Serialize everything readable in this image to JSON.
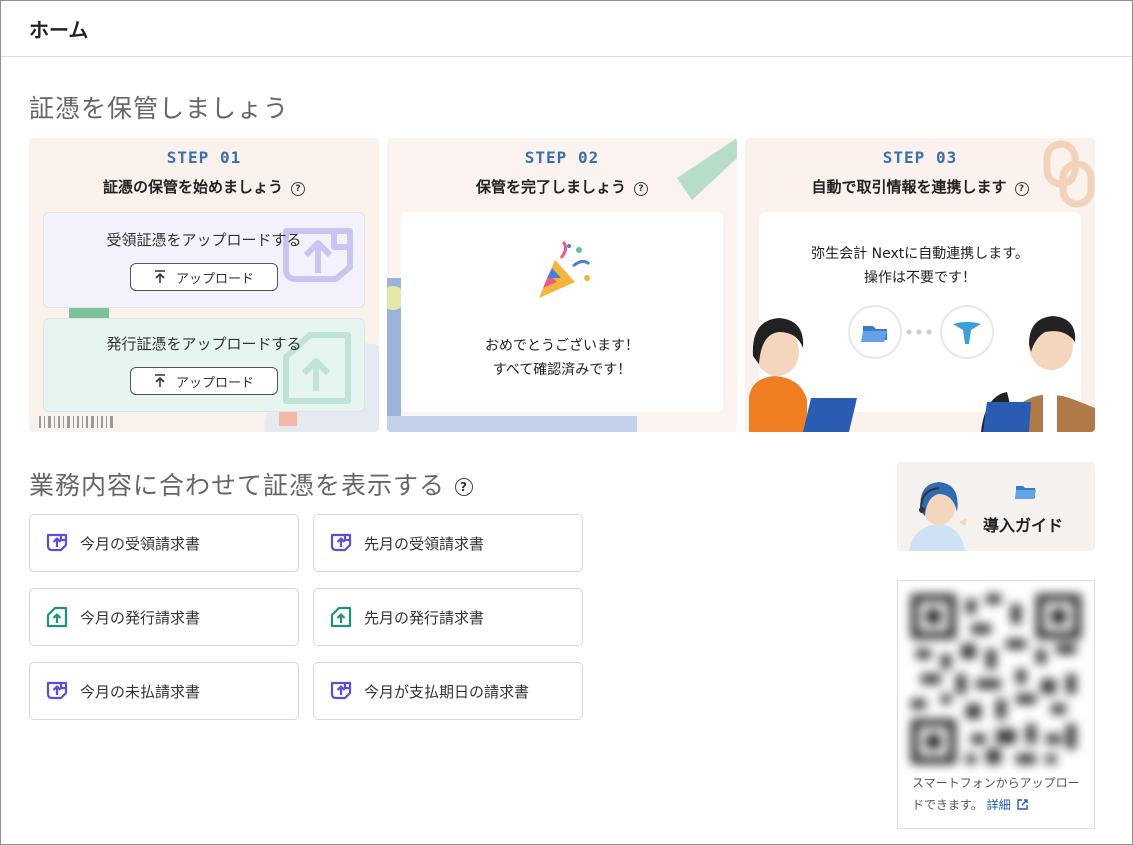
{
  "header": {
    "title": "ホーム"
  },
  "section1": {
    "title": "証憑を保管しましょう"
  },
  "steps": [
    {
      "label": "STEP 01",
      "heading": "証憑の保管を始めましょう",
      "received": {
        "label": "受領証憑をアップロードする",
        "button": "アップロード"
      },
      "issued": {
        "label": "発行証憑をアップロードする",
        "button": "アップロード"
      }
    },
    {
      "label": "STEP 02",
      "heading": "保管を完了しましょう",
      "message_line1": "おめでとうございます！",
      "message_line2": "すべて確認済みです！"
    },
    {
      "label": "STEP 03",
      "heading": "自動で取引情報を連携します",
      "message_line1": "弥生会計 Nextに自動連携します。",
      "message_line2": "操作は不要です！"
    }
  ],
  "section2": {
    "title": "業務内容に合わせて証憑を表示する"
  },
  "filters": [
    {
      "label": "今月の受領請求書",
      "icon": "receive-icon"
    },
    {
      "label": "先月の受領請求書",
      "icon": "receive-icon"
    },
    {
      "label": "今月の発行請求書",
      "icon": "issue-icon"
    },
    {
      "label": "先月の発行請求書",
      "icon": "issue-icon"
    },
    {
      "label": "今月の未払請求書",
      "icon": "receive-icon"
    },
    {
      "label": "今月が支払期日の請求書",
      "icon": "receive-icon"
    }
  ],
  "guide": {
    "label": "導入ガイド"
  },
  "qr": {
    "text": "スマートフォンからアップロードできます。",
    "link": "詳細"
  },
  "colors": {
    "accent_blue": "#3d6fb0",
    "receive_purple": "#5b4fd6",
    "issue_green": "#23907a"
  }
}
